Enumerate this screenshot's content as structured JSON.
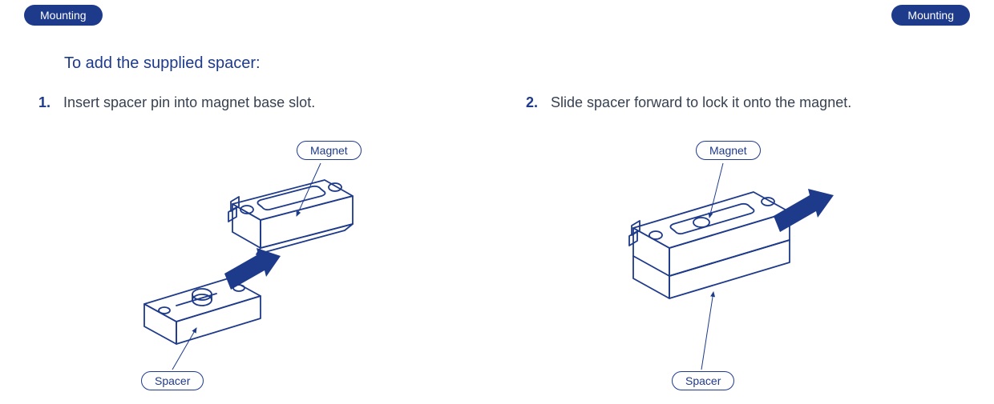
{
  "header": {
    "left_tag": "Mounting",
    "right_tag": "Mounting"
  },
  "title": "To add the supplied spacer:",
  "steps": [
    {
      "num": "1.",
      "text": "Insert spacer pin into magnet base slot."
    },
    {
      "num": "2.",
      "text": "Slide spacer forward to lock it onto the magnet."
    }
  ],
  "labels": {
    "magnet": "Magnet",
    "spacer": "Spacer"
  }
}
